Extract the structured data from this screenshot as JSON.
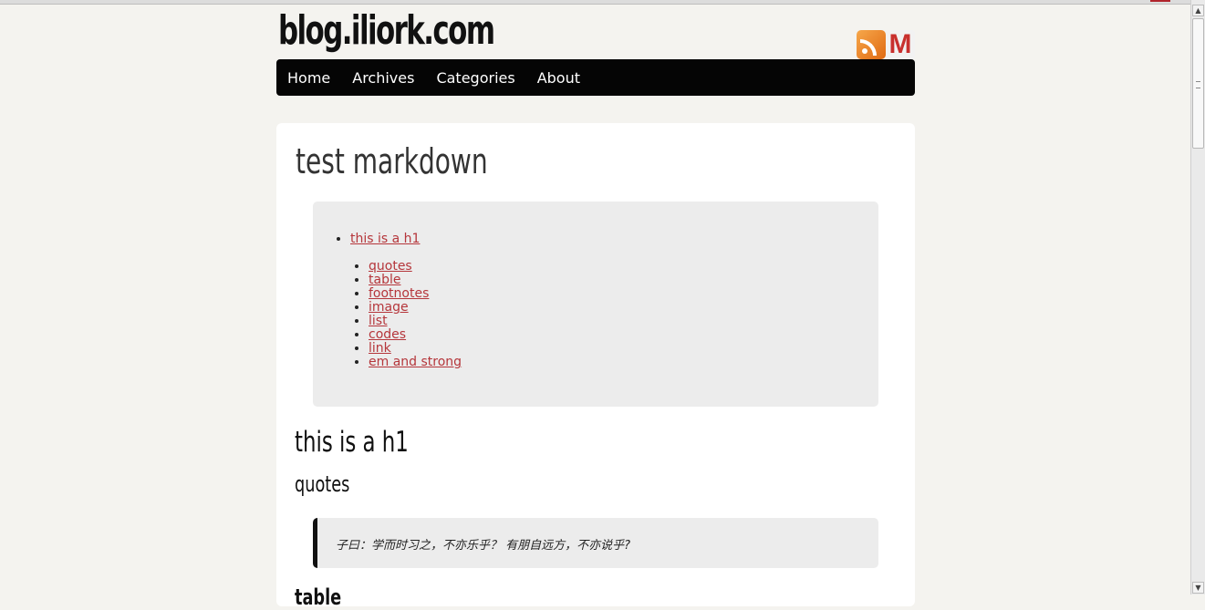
{
  "site": {
    "brand": "blog.iliork.com"
  },
  "header": {
    "rss_icon": "rss-icon",
    "mail_icon": "gmail-icon",
    "mail_glyph": "M"
  },
  "nav": {
    "items": [
      {
        "label": "Home"
      },
      {
        "label": "Archives"
      },
      {
        "label": "Categories"
      },
      {
        "label": "About"
      }
    ]
  },
  "post": {
    "title": "test markdown",
    "toc": {
      "top": "this is a h1",
      "items": [
        "quotes",
        "table",
        "footnotes",
        "image",
        "list",
        "codes",
        "link",
        "em and strong"
      ]
    },
    "h1": "this is a h1",
    "section_quotes": "quotes",
    "quote_text": "子曰：学而时习之，不亦乐乎？ 有朋自远方，不亦说乎?",
    "section_next_partial": "table"
  },
  "scrollbar": {
    "up": "▲",
    "down": "▼"
  },
  "colors": {
    "link": "#b5363b",
    "nav_bg": "#050505",
    "page_bg": "#f4f3ef",
    "toc_bg": "#ececec"
  }
}
